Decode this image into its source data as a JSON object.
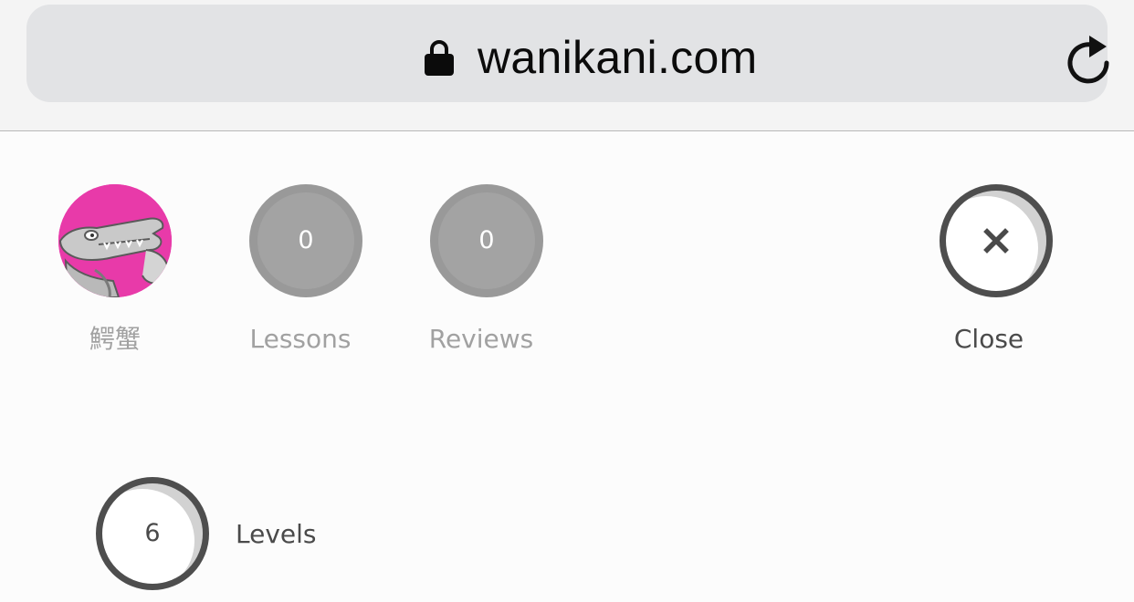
{
  "browser": {
    "url": "wanikani.com",
    "lock_icon": "lock-icon",
    "reload_icon": "reload-icon"
  },
  "nav": {
    "profile": {
      "label": "鰐蟹",
      "avatar": "crocodile-avatar"
    },
    "lessons": {
      "count": "0",
      "label": "Lessons"
    },
    "reviews": {
      "count": "0",
      "label": "Reviews"
    },
    "close": {
      "label": "Close",
      "icon": "close-icon"
    }
  },
  "levels": {
    "count": "6",
    "label": "Levels"
  },
  "colors": {
    "avatar_background": "#e83aa9",
    "count_circle": "#a3a3a3",
    "outline": "#4e4e4e"
  }
}
